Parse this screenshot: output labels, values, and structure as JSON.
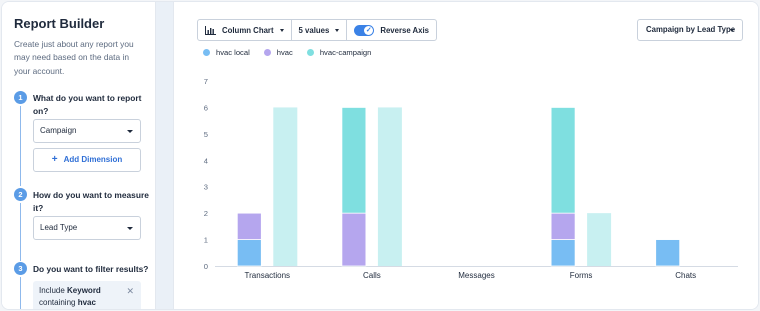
{
  "sidebar": {
    "title": "Report Builder",
    "description": "Create just about any report you may need based on the data in your account.",
    "steps": [
      {
        "number": "1",
        "question": "What do you want to report on?",
        "select_value": "Campaign",
        "add_label": "Add Dimension"
      },
      {
        "number": "2",
        "question": "How do you want to measure it?",
        "select_value": "Lead Type"
      },
      {
        "number": "3",
        "question": "Do you want to filter results?",
        "filter_prefix": "Include",
        "filter_keyword": "Keyword",
        "filter_mid": "containing",
        "filter_value": "hvac"
      }
    ]
  },
  "toolbar": {
    "chart_type": "Column Chart",
    "values_count": "5 values",
    "reverse_axis_label": "Reverse Axis",
    "reverse_axis_on": true,
    "group_by": "Campaign by Lead Type"
  },
  "colors": {
    "hvac_local": "#78bdf3",
    "hvac": "#b5a6ee",
    "hvac_campaign": "#7fdfe0",
    "hvac_campaign_light": "#c8f0f1",
    "accent": "#3b82e6"
  },
  "chart_data": {
    "type": "bar",
    "stacked": true,
    "categories": [
      "Transactions",
      "Calls",
      "Messages",
      "Forms",
      "Chats"
    ],
    "series": [
      {
        "name": "hvac local",
        "values": [
          1,
          0,
          0,
          1,
          1
        ]
      },
      {
        "name": "hvac",
        "values": [
          1,
          2,
          0,
          1,
          0
        ]
      },
      {
        "name": "hvac-campaign",
        "values": [
          0,
          4,
          0,
          4,
          0
        ]
      }
    ],
    "secondary_series": {
      "name": "hvac-campaign",
      "values": [
        6,
        6,
        0,
        2,
        0
      ]
    },
    "ylim": [
      0,
      7
    ],
    "yticks": [
      "0",
      "1",
      "2",
      "3",
      "4",
      "5",
      "6",
      "7"
    ],
    "grid": false,
    "legend": "top-left"
  }
}
